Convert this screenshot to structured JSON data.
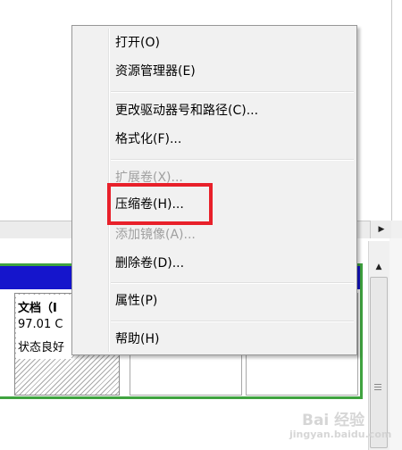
{
  "partition": {
    "name": "文档（I",
    "size": "97.01 C",
    "status": "状态良好"
  },
  "context_menu": {
    "items": [
      {
        "label": "打开(O)",
        "enabled": true
      },
      {
        "label": "资源管理器(E)",
        "enabled": true
      },
      {
        "label": "更改驱动器号和路径(C)...",
        "enabled": true
      },
      {
        "label": "格式化(F)...",
        "enabled": true
      },
      {
        "label": "扩展卷(X)...",
        "enabled": false
      },
      {
        "label": "压缩卷(H)...",
        "enabled": true
      },
      {
        "label": "添加镜像(A)...",
        "enabled": false
      },
      {
        "label": "删除卷(D)...",
        "enabled": true
      },
      {
        "label": "属性(P)",
        "enabled": true
      },
      {
        "label": "帮助(H)",
        "enabled": true
      }
    ]
  },
  "highlight": {
    "target": "压缩卷(H)...",
    "color": "#e8202a"
  },
  "watermark": {
    "line1": "Bai 经验",
    "line2": "jingyan.baidu.com"
  },
  "colors": {
    "volume_bar": "#1515cc",
    "selection_frame": "#3fa33f",
    "menu_bg": "#f1f1f1",
    "disabled_text": "#a0a0a0"
  }
}
